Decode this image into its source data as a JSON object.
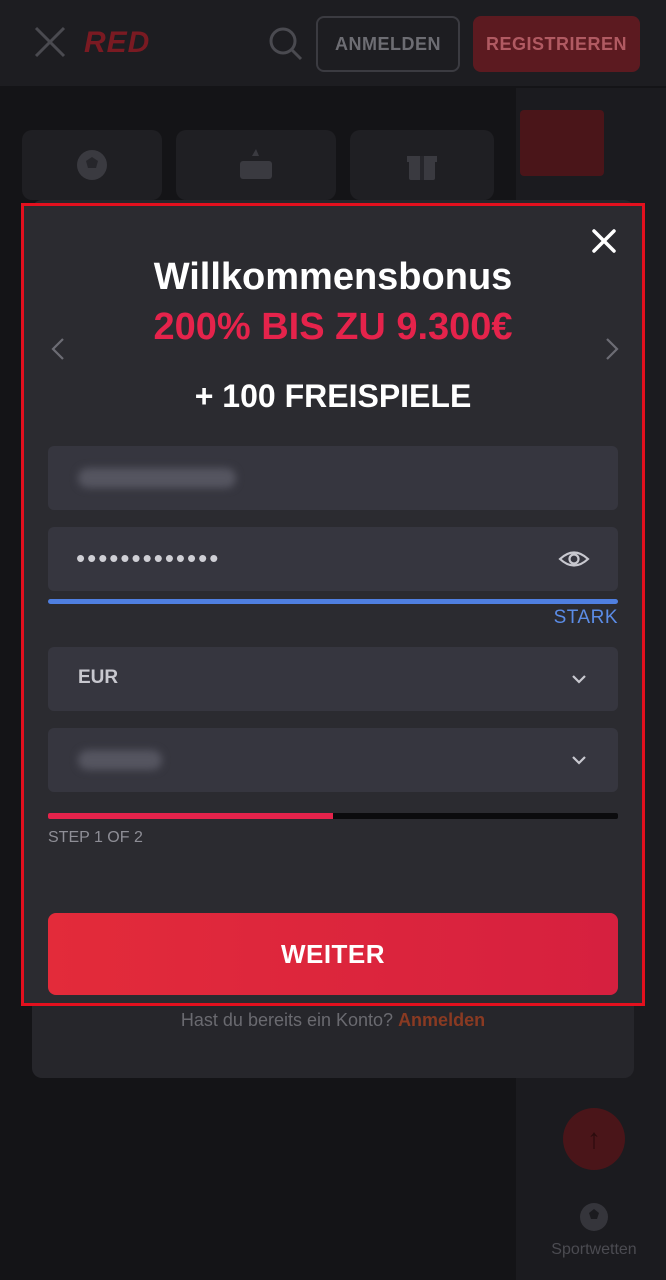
{
  "header": {
    "logo_text": "RED",
    "login_label": "ANMELDEN",
    "register_label": "REGISTRIEREN"
  },
  "modal": {
    "title": "Willkommensbonus",
    "offer": "200% BIS ZU 9.300€",
    "free_spins": "+ 100 FREISPIELE",
    "password": {
      "value": "•••••••••••••",
      "strength_label": "STARK",
      "strength_level": 1.0
    },
    "currency": {
      "selected": "EUR"
    },
    "progress": {
      "label": "STEP 1 OF 2",
      "current_step": 1,
      "total_steps": 2
    },
    "submit_label": "WEITER"
  },
  "footer": {
    "login_prompt": "Hast du bereits ein Konto?",
    "login_link": "Anmelden"
  },
  "bottom_nav": {
    "sports_label": "Sportwetten"
  },
  "colors": {
    "accent_red": "#e5234b",
    "button_red": "#e32b3a",
    "strength_blue": "#4f7fe0",
    "modal_border": "#e3101e"
  }
}
